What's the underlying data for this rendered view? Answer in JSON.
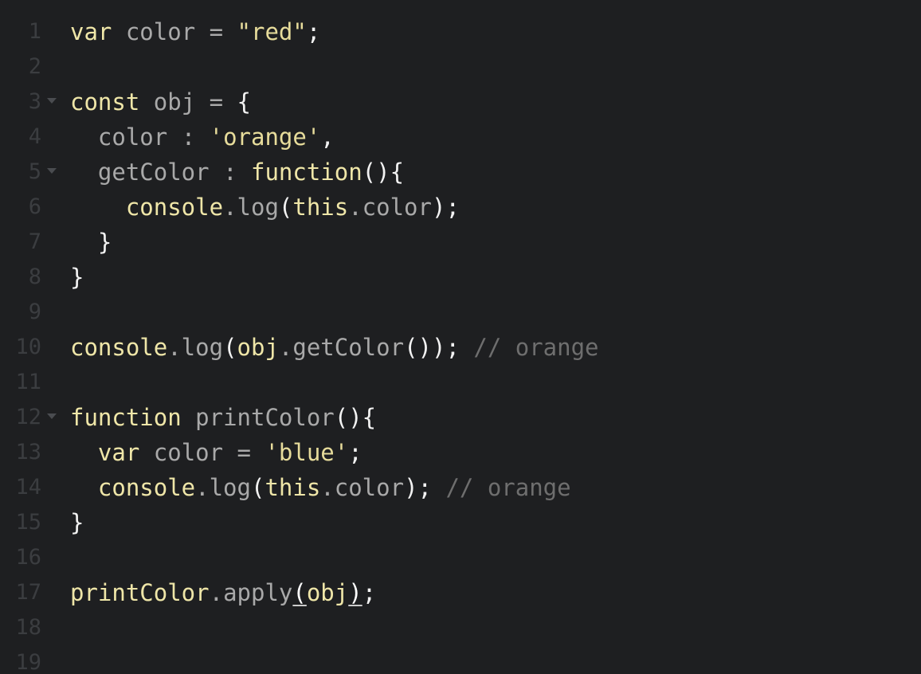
{
  "editor": {
    "lines": [
      {
        "num": "1",
        "fold": false,
        "tokens": [
          {
            "t": "var",
            "c": "kw"
          },
          {
            "t": " color ",
            "c": "id"
          },
          {
            "t": "=",
            "c": "id"
          },
          {
            "t": " ",
            "c": "id"
          },
          {
            "t": "\"red\"",
            "c": "str"
          },
          {
            "t": ";",
            "c": "punc"
          }
        ]
      },
      {
        "num": "2",
        "fold": false,
        "tokens": []
      },
      {
        "num": "3",
        "fold": true,
        "tokens": [
          {
            "t": "const",
            "c": "kw"
          },
          {
            "t": " obj ",
            "c": "id"
          },
          {
            "t": "=",
            "c": "id"
          },
          {
            "t": " {",
            "c": "punc"
          }
        ]
      },
      {
        "num": "4",
        "fold": false,
        "tokens": [
          {
            "t": "  color ",
            "c": "id"
          },
          {
            "t": ": ",
            "c": "id"
          },
          {
            "t": "'orange'",
            "c": "str"
          },
          {
            "t": ",",
            "c": "punc"
          }
        ]
      },
      {
        "num": "5",
        "fold": true,
        "tokens": [
          {
            "t": "  getColor ",
            "c": "id"
          },
          {
            "t": ": ",
            "c": "id"
          },
          {
            "t": "function",
            "c": "kw"
          },
          {
            "t": "(){",
            "c": "punc"
          }
        ]
      },
      {
        "num": "6",
        "fold": false,
        "tokens": [
          {
            "t": "    console",
            "c": "kw"
          },
          {
            "t": ".log",
            "c": "id"
          },
          {
            "t": "(",
            "c": "punc"
          },
          {
            "t": "this",
            "c": "kw"
          },
          {
            "t": ".color",
            "c": "id"
          },
          {
            "t": ");",
            "c": "punc"
          }
        ]
      },
      {
        "num": "7",
        "fold": false,
        "tokens": [
          {
            "t": "  }",
            "c": "punc"
          }
        ]
      },
      {
        "num": "8",
        "fold": false,
        "tokens": [
          {
            "t": "}",
            "c": "punc"
          }
        ]
      },
      {
        "num": "9",
        "fold": false,
        "tokens": []
      },
      {
        "num": "10",
        "fold": false,
        "tokens": [
          {
            "t": "console",
            "c": "kw"
          },
          {
            "t": ".log",
            "c": "id"
          },
          {
            "t": "(",
            "c": "punc"
          },
          {
            "t": "obj",
            "c": "kw"
          },
          {
            "t": ".getColor",
            "c": "id"
          },
          {
            "t": "());",
            "c": "punc"
          },
          {
            "t": " // orange",
            "c": "cmt"
          }
        ]
      },
      {
        "num": "11",
        "fold": false,
        "tokens": []
      },
      {
        "num": "12",
        "fold": true,
        "tokens": [
          {
            "t": "function",
            "c": "kw"
          },
          {
            "t": " printColor",
            "c": "id"
          },
          {
            "t": "(){",
            "c": "punc"
          }
        ]
      },
      {
        "num": "13",
        "fold": false,
        "tokens": [
          {
            "t": "  var",
            "c": "kw"
          },
          {
            "t": " color ",
            "c": "id"
          },
          {
            "t": "=",
            "c": "id"
          },
          {
            "t": " ",
            "c": "id"
          },
          {
            "t": "'blue'",
            "c": "str"
          },
          {
            "t": ";",
            "c": "punc"
          }
        ]
      },
      {
        "num": "14",
        "fold": false,
        "tokens": [
          {
            "t": "  console",
            "c": "kw"
          },
          {
            "t": ".log",
            "c": "id"
          },
          {
            "t": "(",
            "c": "punc"
          },
          {
            "t": "this",
            "c": "kw"
          },
          {
            "t": ".color",
            "c": "id"
          },
          {
            "t": ");",
            "c": "punc"
          },
          {
            "t": " // orange",
            "c": "cmt"
          }
        ]
      },
      {
        "num": "15",
        "fold": false,
        "tokens": [
          {
            "t": "}",
            "c": "punc"
          }
        ]
      },
      {
        "num": "16",
        "fold": false,
        "tokens": []
      },
      {
        "num": "17",
        "fold": false,
        "tokens": [
          {
            "t": "printColor",
            "c": "kw"
          },
          {
            "t": ".apply",
            "c": "id"
          },
          {
            "t": "(",
            "c": "cur"
          },
          {
            "t": "obj",
            "c": "kw"
          },
          {
            "t": ")",
            "c": "cur"
          },
          {
            "t": ";",
            "c": "punc"
          }
        ]
      },
      {
        "num": "18",
        "fold": false,
        "tokens": []
      },
      {
        "num": "19",
        "fold": false,
        "tokens": []
      }
    ]
  },
  "icons": {
    "fold": "chevron-down-icon"
  },
  "colors": {
    "background": "#1e1f21",
    "keyword": "#efe6a8",
    "identifier": "#a9a9a9",
    "string": "#e7dc9b",
    "punctuation": "#f2f2f2",
    "comment": "#6e6e6e",
    "gutter": "#3b3d40"
  }
}
